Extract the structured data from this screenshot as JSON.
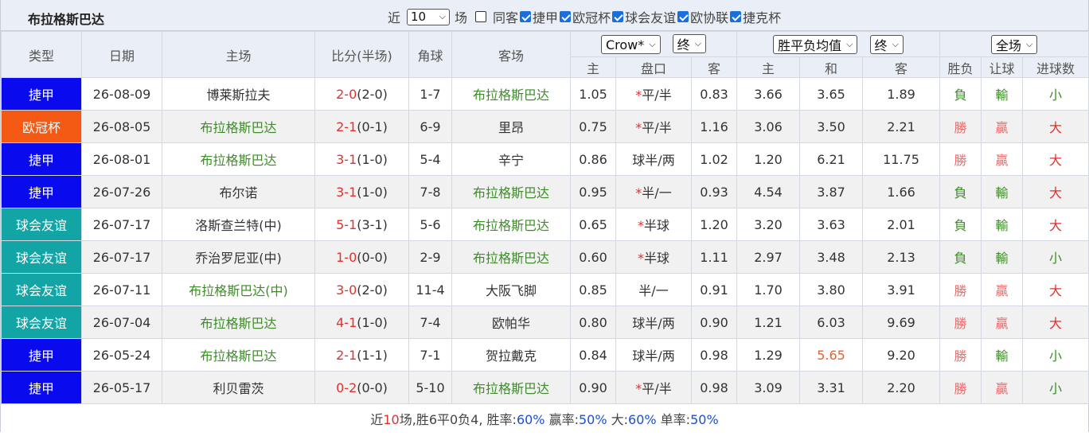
{
  "header": {
    "team_title": "布拉格斯巴达",
    "near_label": "近",
    "count_value": "10",
    "count_unit": "场",
    "same_label": "同客",
    "leagues": [
      "捷甲",
      "欧冠杯",
      "球会友谊",
      "欧协联",
      "捷克杯"
    ]
  },
  "table": {
    "columns": {
      "type": "类型",
      "date": "日期",
      "home": "主场",
      "score": "比分(半场)",
      "corner": "角球",
      "away": "客场",
      "handicap_company": "Crow*",
      "handicap_stage": "终",
      "odds_type": "胜平负均值",
      "odds_stage": "终",
      "scope": "全场",
      "h_home": "主",
      "h_line": "盘口",
      "h_away": "客",
      "o_home": "主",
      "o_draw": "和",
      "o_away": "客",
      "result": "胜负",
      "handicap_result": "让球",
      "goals": "进球数"
    },
    "league_colors": {
      "捷甲": "#0a0aef",
      "欧冠杯": "#f55a15",
      "球会友谊": "#13a5a5"
    },
    "rows": [
      {
        "league": "捷甲",
        "date": "26-08-09",
        "home": "博莱斯拉夫",
        "home_team": false,
        "score_ft": "2-0",
        "score_ht": "(2-0)",
        "corner": "1-7",
        "away": "布拉格斯巴达",
        "away_team": true,
        "hh": "1.05",
        "hl_star": "*",
        "hl": "平/半",
        "ha": "0.83",
        "oh": "3.66",
        "od": "3.65",
        "od_hl": false,
        "oa": "1.89",
        "res": "負",
        "hres": "輸",
        "goals": "小",
        "alt": false
      },
      {
        "league": "欧冠杯",
        "date": "26-08-05",
        "home": "布拉格斯巴达",
        "home_team": true,
        "score_ft": "2-1",
        "score_ht": "(0-1)",
        "corner": "6-9",
        "away": "里昂",
        "away_team": false,
        "hh": "0.75",
        "hl_star": "*",
        "hl": "平/半",
        "ha": "1.16",
        "oh": "3.06",
        "od": "3.50",
        "od_hl": false,
        "oa": "2.21",
        "res": "勝",
        "hres": "贏",
        "goals": "大",
        "alt": true
      },
      {
        "league": "捷甲",
        "date": "26-08-01",
        "home": "布拉格斯巴达",
        "home_team": true,
        "score_ft": "3-1",
        "score_ht": "(1-0)",
        "corner": "5-4",
        "away": "辛宁",
        "away_team": false,
        "hh": "0.86",
        "hl_star": "",
        "hl": "球半/两",
        "ha": "1.02",
        "oh": "1.20",
        "od": "6.21",
        "od_hl": false,
        "oa": "11.75",
        "res": "勝",
        "hres": "贏",
        "goals": "大",
        "alt": false
      },
      {
        "league": "捷甲",
        "date": "26-07-26",
        "home": "布尔诺",
        "home_team": false,
        "score_ft": "3-1",
        "score_ht": "(1-0)",
        "corner": "7-8",
        "away": "布拉格斯巴达",
        "away_team": true,
        "hh": "0.95",
        "hl_star": "*",
        "hl": "半/一",
        "ha": "0.93",
        "oh": "4.54",
        "od": "3.87",
        "od_hl": false,
        "oa": "1.66",
        "res": "負",
        "hres": "輸",
        "goals": "大",
        "alt": true
      },
      {
        "league": "球会友谊",
        "date": "26-07-17",
        "home": "洛斯查兰特(中)",
        "home_team": false,
        "score_ft": "5-1",
        "score_ht": "(3-1)",
        "corner": "5-6",
        "away": "布拉格斯巴达",
        "away_team": true,
        "hh": "0.65",
        "hl_star": "*",
        "hl": "半球",
        "ha": "1.20",
        "oh": "3.20",
        "od": "3.63",
        "od_hl": false,
        "oa": "2.01",
        "res": "負",
        "hres": "輸",
        "goals": "大",
        "alt": false
      },
      {
        "league": "球会友谊",
        "date": "26-07-17",
        "home": "乔治罗尼亚(中)",
        "home_team": false,
        "score_ft": "1-0",
        "score_ht": "(0-0)",
        "corner": "2-9",
        "away": "布拉格斯巴达",
        "away_team": true,
        "hh": "0.60",
        "hl_star": "*",
        "hl": "半球",
        "ha": "1.11",
        "oh": "2.97",
        "od": "3.48",
        "od_hl": false,
        "oa": "2.13",
        "res": "負",
        "hres": "輸",
        "goals": "小",
        "alt": true
      },
      {
        "league": "球会友谊",
        "date": "26-07-11",
        "home": "布拉格斯巴达(中)",
        "home_team": true,
        "score_ft": "3-0",
        "score_ht": "(2-0)",
        "corner": "11-4",
        "away": "大阪飞脚",
        "away_team": false,
        "hh": "0.85",
        "hl_star": "",
        "hl": "半/一",
        "ha": "0.91",
        "oh": "1.70",
        "od": "3.80",
        "od_hl": false,
        "oa": "3.91",
        "res": "勝",
        "hres": "贏",
        "goals": "大",
        "alt": false
      },
      {
        "league": "球会友谊",
        "date": "26-07-04",
        "home": "布拉格斯巴达",
        "home_team": true,
        "score_ft": "4-1",
        "score_ht": "(1-0)",
        "corner": "7-4",
        "away": "欧帕华",
        "away_team": false,
        "hh": "0.80",
        "hl_star": "",
        "hl": "球半/两",
        "ha": "0.90",
        "oh": "1.21",
        "od": "6.03",
        "od_hl": false,
        "oa": "9.69",
        "res": "勝",
        "hres": "贏",
        "goals": "大",
        "alt": true
      },
      {
        "league": "捷甲",
        "date": "26-05-24",
        "home": "布拉格斯巴达",
        "home_team": true,
        "score_ft": "2-1",
        "score_ht": "(1-1)",
        "corner": "7-1",
        "away": "贺拉戴克",
        "away_team": false,
        "hh": "0.84",
        "hl_star": "",
        "hl": "球半/两",
        "ha": "0.98",
        "oh": "1.29",
        "od": "5.65",
        "od_hl": true,
        "oa": "9.20",
        "res": "勝",
        "hres": "輸",
        "goals": "小",
        "alt": false
      },
      {
        "league": "捷甲",
        "date": "26-05-17",
        "home": "利贝雷茨",
        "home_team": false,
        "score_ft": "0-2",
        "score_ht": "(0-0)",
        "corner": "5-10",
        "away": "布拉格斯巴达",
        "away_team": true,
        "hh": "0.90",
        "hl_star": "*",
        "hl": "平/半",
        "ha": "0.98",
        "oh": "3.09",
        "od": "3.31",
        "od_hl": false,
        "oa": "2.20",
        "res": "勝",
        "hres": "贏",
        "goals": "小",
        "alt": true
      }
    ]
  },
  "summary": {
    "prefix": "近",
    "games": "10",
    "mid": "场,胜6平0负4, 胜率:",
    "win_rate": "60%",
    "ying_label": " 赢率:",
    "ying_rate": "50%",
    "big_label": " 大:",
    "big_rate": "60%",
    "single_label": " 单率:",
    "single_rate": "50%"
  }
}
